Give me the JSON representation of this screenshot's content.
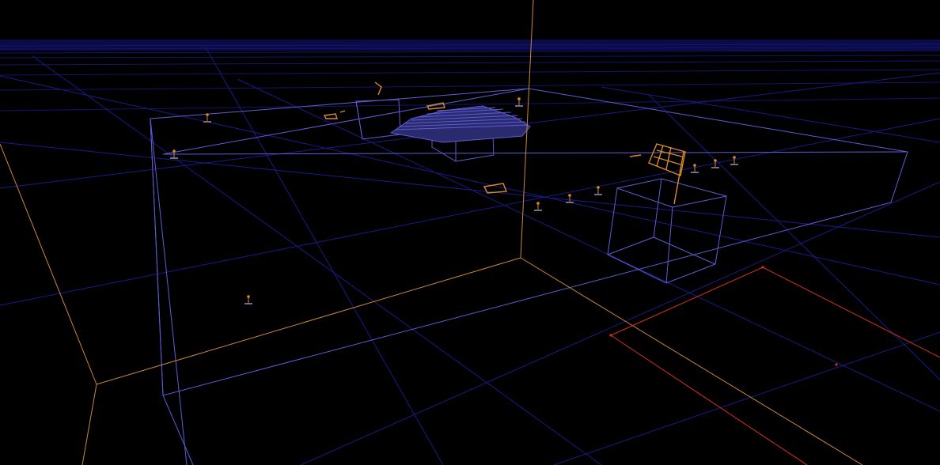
{
  "viewport": {
    "mode": "3d-wireframe",
    "colors": {
      "background": "#000000",
      "grid": "#1a1a8a",
      "brush": "#5d5dd6",
      "axis": "#c98a3c",
      "selection": "#d4321e",
      "entity": "#d88a2e"
    }
  },
  "entities": [
    {
      "kind": "point-entity"
    },
    {
      "kind": "point-entity"
    },
    {
      "kind": "point-entity"
    },
    {
      "kind": "point-entity"
    },
    {
      "kind": "point-entity"
    },
    {
      "kind": "point-entity"
    },
    {
      "kind": "point-entity"
    },
    {
      "kind": "point-entity"
    },
    {
      "kind": "point-entity"
    },
    {
      "kind": "point-entity"
    }
  ]
}
